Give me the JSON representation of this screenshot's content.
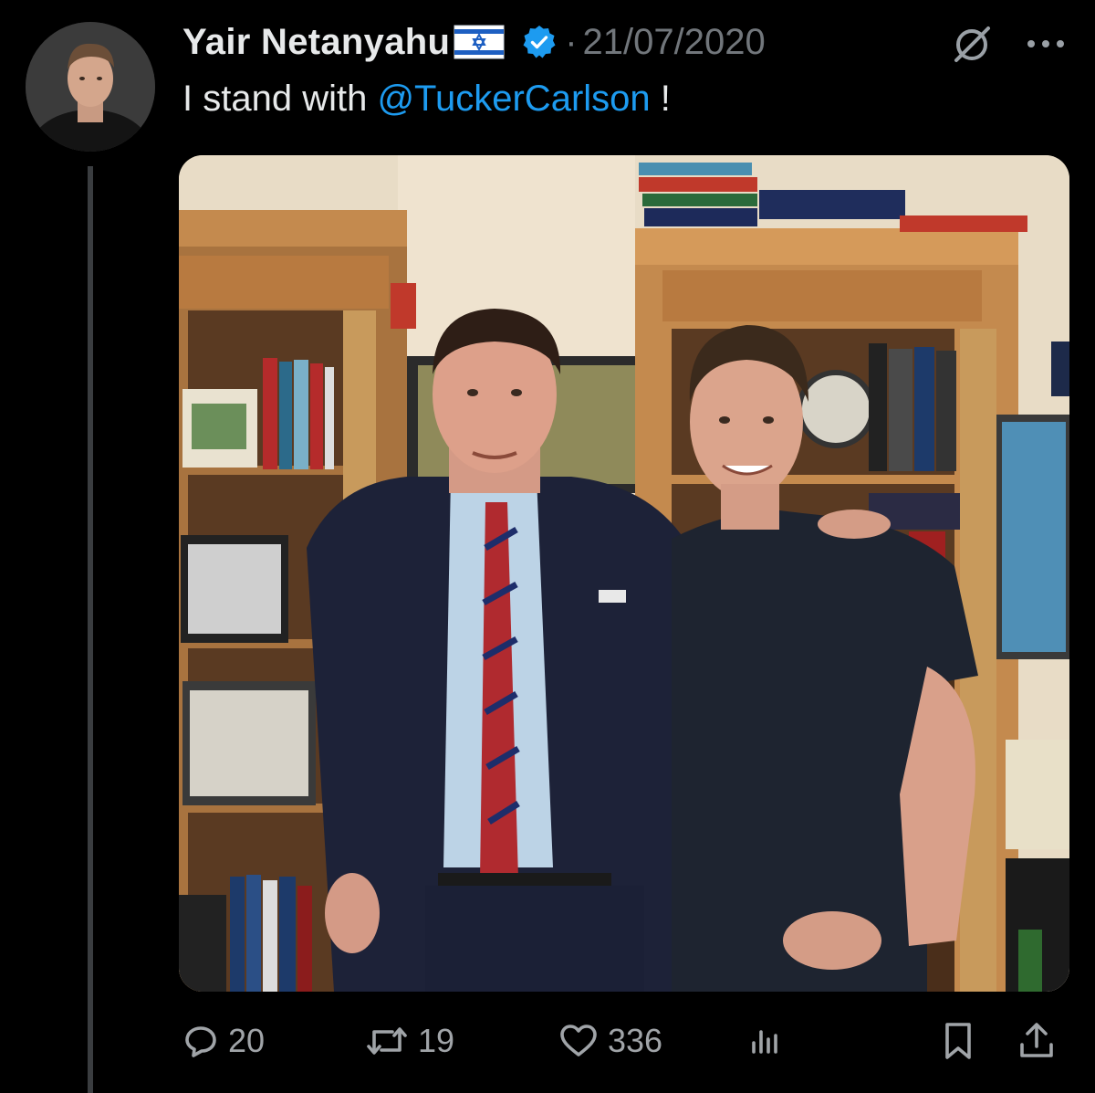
{
  "author": {
    "display_name": "Yair Netanyahu",
    "flag_icon": "israel-flag-icon",
    "verified_icon": "verified-badge-icon",
    "verified_color": "#1d9bf0",
    "separator": "·",
    "timestamp": "21/07/2020"
  },
  "tweet": {
    "text_before": "I stand with ",
    "mention": "@TuckerCarlson",
    "text_after": " !",
    "mention_color": "#1d9bf0"
  },
  "header_icons": {
    "grok": "grok-icon",
    "more": "more-options-icon"
  },
  "actions": {
    "replies": {
      "icon": "reply-icon",
      "count": "20"
    },
    "retweets": {
      "icon": "retweet-icon",
      "count": "19"
    },
    "likes": {
      "icon": "like-icon",
      "count": "336"
    },
    "views": {
      "icon": "analytics-icon"
    },
    "bookmark": {
      "icon": "bookmark-icon"
    },
    "share": {
      "icon": "share-icon"
    }
  },
  "colors": {
    "background": "#000000",
    "text_primary": "#e7e9ea",
    "text_secondary": "#71767b",
    "action_icon": "#a0a4a8"
  }
}
